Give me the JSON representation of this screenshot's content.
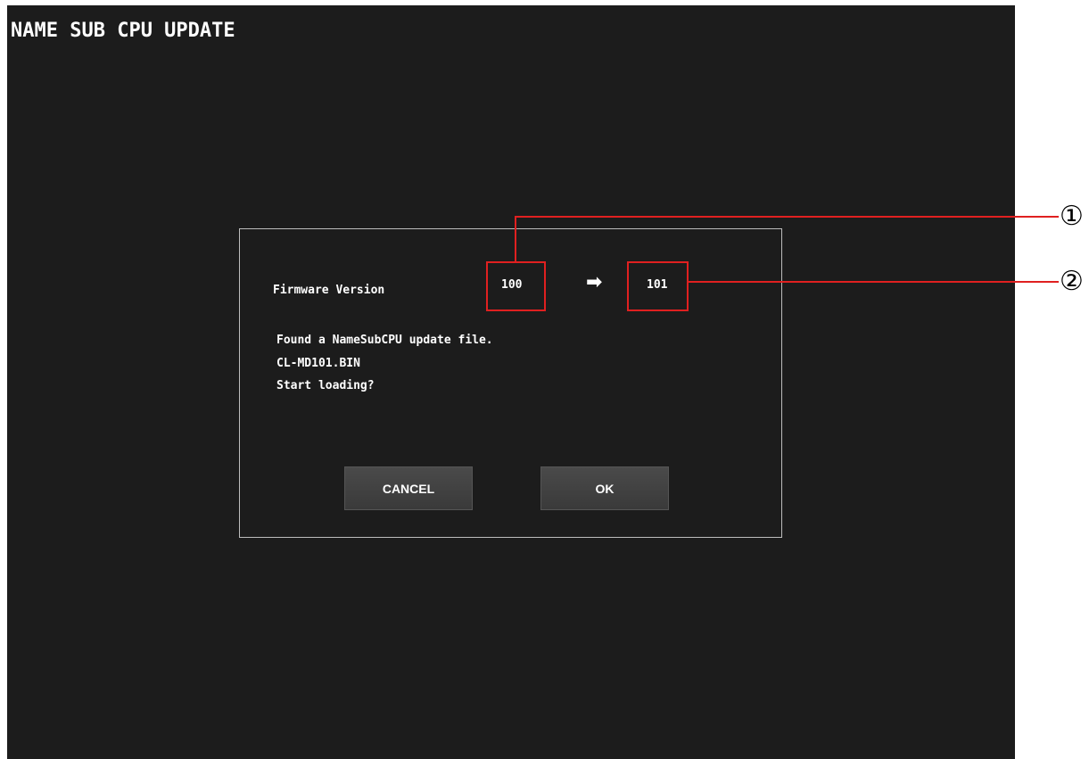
{
  "screen": {
    "title": "NAME SUB CPU UPDATE"
  },
  "dialog": {
    "firmware_label": "Firmware Version",
    "current_version": "100",
    "new_version": "101",
    "arrow_icon": "right-arrow-icon",
    "message_lines": [
      "Found a NameSubCPU update file.",
      "CL-MD101.BIN",
      "Start loading?"
    ],
    "cancel_label": "CANCEL",
    "ok_label": "OK"
  },
  "callouts": [
    {
      "label": "①"
    },
    {
      "label": "②"
    }
  ],
  "colors": {
    "screen_bg": "#1c1c1c",
    "callout": "#e02020",
    "button_bg": "#434343"
  }
}
